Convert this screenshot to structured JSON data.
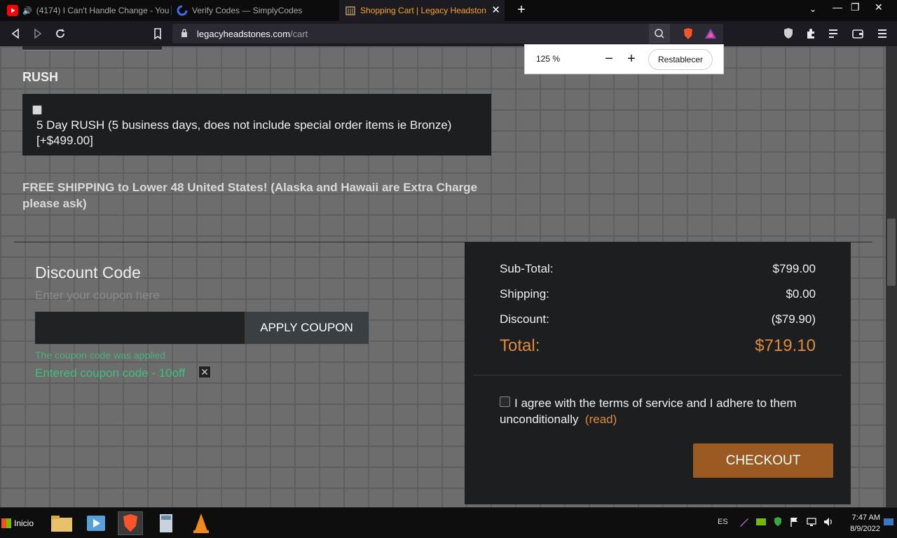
{
  "tabs": [
    {
      "title": "(4174) I Can't Handle Change - You",
      "icon": "youtube-icon",
      "audio": true
    },
    {
      "title": "Verify Codes — SimplyCodes",
      "icon": "simplycodes-icon"
    },
    {
      "title": "Shopping Cart | Legacy Headstone",
      "icon": "legacy-headstones-icon",
      "active": true
    }
  ],
  "address": {
    "domain": "legacyheadstones.com",
    "path": "/cart"
  },
  "zoom": {
    "percent": "125 %",
    "minus": "−",
    "plus": "+",
    "reset": "Restablecer"
  },
  "page": {
    "rush_title": "RUSH",
    "rush_option": "5 Day RUSH (5 business days, does not include special order items ie Bronze) [+$499.00]",
    "free_shipping": "FREE SHIPPING to Lower 48 United States! (Alaska and Hawaii are Extra Charge please ask)",
    "discount": {
      "title": "Discount Code",
      "subtitle": "Enter your coupon here",
      "input_value": "",
      "apply_label": "APPLY COUPON",
      "applied_msg": "The coupon code was applied",
      "entered_msg": "Entered coupon code - 10off",
      "remove_glyph": "✕"
    },
    "summary": {
      "subtotal_label": "Sub-Total:",
      "subtotal": "$799.00",
      "shipping_label": "Shipping:",
      "shipping": "$0.00",
      "discount_label": "Discount:",
      "discount": "($79.90)",
      "total_label": "Total:",
      "total": "$719.10",
      "agree_text": "I agree with the terms of service and I adhere to them unconditionally",
      "read_link": "(read)",
      "checkout_label": "CHECKOUT"
    }
  },
  "taskbar": {
    "start_label": "Inicio",
    "lang": "ES",
    "time": "7:47 AM",
    "date": "8/9/2022"
  },
  "colors": {
    "accent_orange": "#e08a3c",
    "checkout_bg": "#9a5a22",
    "success_green": "#3fbf80"
  }
}
